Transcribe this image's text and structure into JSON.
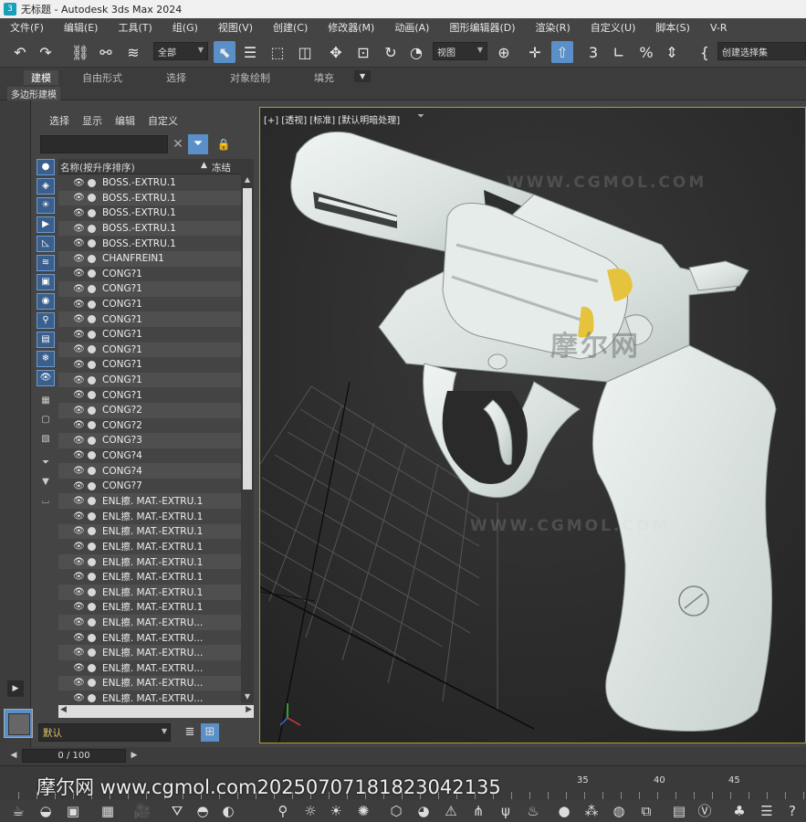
{
  "window": {
    "title": "无标题 - Autodesk 3ds Max 2024"
  },
  "menubar": {
    "items": [
      "文件(F)",
      "编辑(E)",
      "工具(T)",
      "组(G)",
      "视图(V)",
      "创建(C)",
      "修改器(M)",
      "动画(A)",
      "图形编辑器(D)",
      "渲染(R)",
      "自定义(U)",
      "脚本(S)",
      "V-R"
    ]
  },
  "toolbar": {
    "selection_filter": "全部",
    "ref_coord": "视图",
    "named_selection": "创建选择集"
  },
  "ribbon": {
    "tabs": [
      "建模",
      "自由形式",
      "选择",
      "对象绘制",
      "填充"
    ],
    "active_tab": "建模",
    "sub_label": "多边形建模"
  },
  "explorer": {
    "menu": [
      "选择",
      "显示",
      "编辑",
      "自定义"
    ],
    "col_name": "名称(按升序排序)",
    "col_freeze": "冻结",
    "items": [
      "BOSS.-EXTRU.1",
      "BOSS.-EXTRU.1",
      "BOSS.-EXTRU.1",
      "BOSS.-EXTRU.1",
      "BOSS.-EXTRU.1",
      "CHANFREIN1",
      "CONG?1",
      "CONG?1",
      "CONG?1",
      "CONG?1",
      "CONG?1",
      "CONG?1",
      "CONG?1",
      "CONG?1",
      "CONG?1",
      "CONG?2",
      "CONG?2",
      "CONG?3",
      "CONG?4",
      "CONG?4",
      "CONG?7",
      "ENL擦. MAT.-EXTRU.1",
      "ENL擦. MAT.-EXTRU.1",
      "ENL擦. MAT.-EXTRU.1",
      "ENL擦. MAT.-EXTRU.1",
      "ENL擦. MAT.-EXTRU.1",
      "ENL擦. MAT.-EXTRU.1",
      "ENL擦. MAT.-EXTRU.1",
      "ENL擦. MAT.-EXTRU.1",
      "ENL擦. MAT.-EXTRU...",
      "ENL擦. MAT.-EXTRU...",
      "ENL擦. MAT.-EXTRU...",
      "ENL擦. MAT.-EXTRU...",
      "ENL擦. MAT.-EXTRU...",
      "ENL擦. MAT.-EXTRU..."
    ],
    "layer": "默认"
  },
  "viewport": {
    "label": "[+] [透视] [标准] [默认明暗处理]",
    "watermarks": [
      "WWW.CGMOL.COM",
      "WWW.CGMOL.COM",
      "WWW.CGMOL.COM",
      "摩尔网"
    ],
    "colors": {
      "model": "#dfe6e3",
      "accent": "#e5c33c",
      "border": "#b59b3a"
    }
  },
  "timeline": {
    "frame": "0 / 100",
    "ticks": [
      "35",
      "40",
      "45"
    ]
  },
  "overlay_watermark": "摩尔网 www.cgmol.com20250707181823042135"
}
